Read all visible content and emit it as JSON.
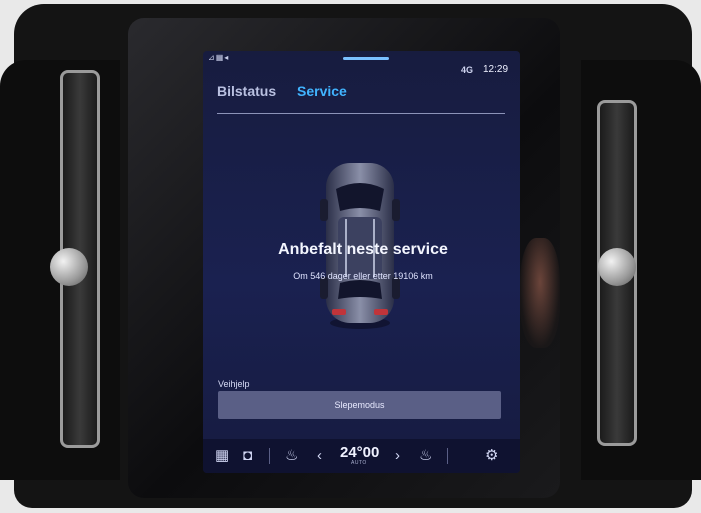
{
  "status_bar": {
    "left_icons": "⊿▦◂",
    "signal": "4G",
    "time": "12:29"
  },
  "tabs": [
    {
      "label": "Bilstatus"
    },
    {
      "label": "Service"
    }
  ],
  "service": {
    "title": "Anbefalt neste service",
    "subtitle": "Om 546 dager eller etter 19106 km"
  },
  "roadside": {
    "label": "Veihjelp",
    "button": "Slepemodus"
  },
  "bottom_bar": {
    "temperature": "24°00",
    "temperature_mode": "AUTO",
    "icons": [
      "apps-grid-icon",
      "camera-icon",
      "seat-heat-icon",
      "chevron-left-icon",
      "chevron-right-icon",
      "seat-heat-icon",
      "settings-gear-icon"
    ]
  },
  "colors": {
    "screen_bg": "#1a2150",
    "accent": "#41b4ff",
    "button_bg": "#5a5f86"
  }
}
